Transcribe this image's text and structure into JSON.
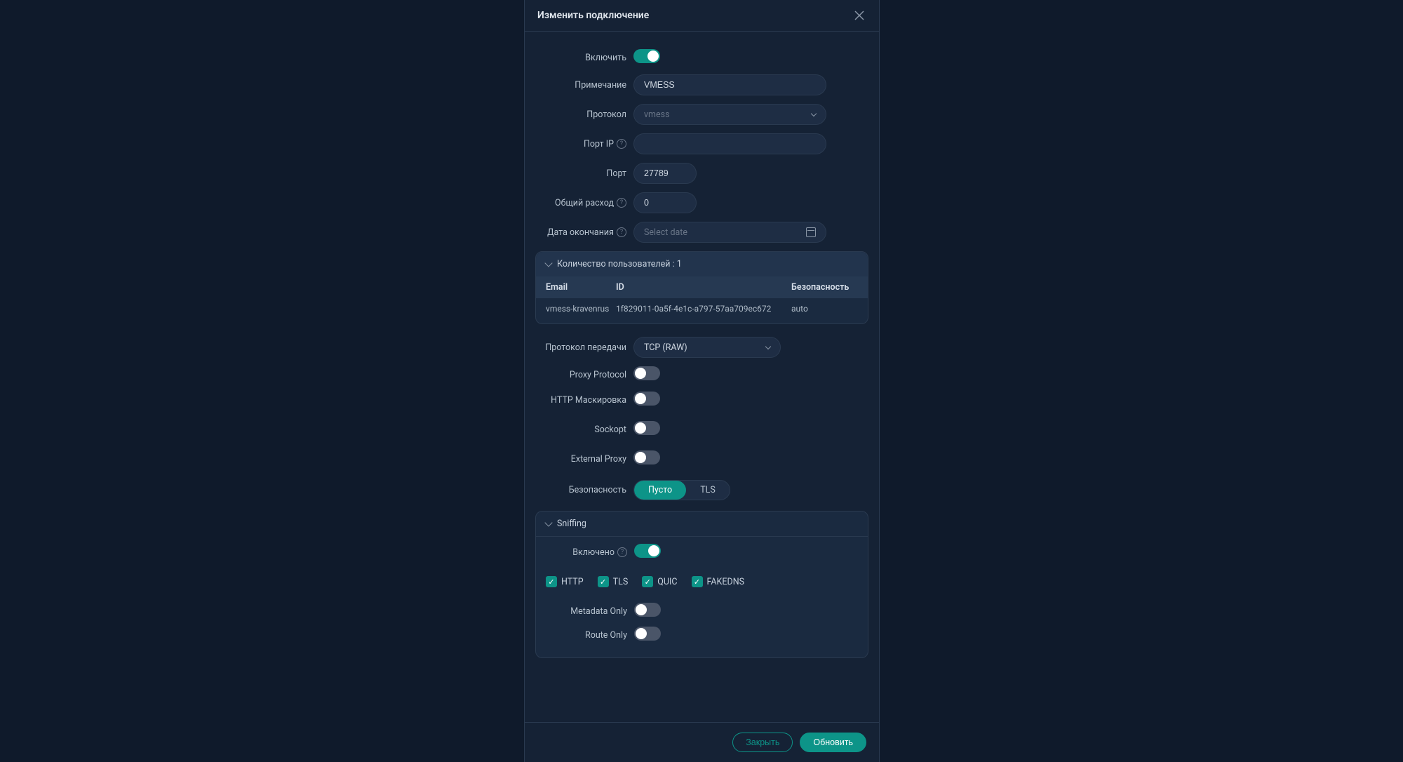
{
  "modal": {
    "title": "Изменить подключение",
    "labels": {
      "enable": "Включить",
      "note": "Примечание",
      "protocol": "Протокол",
      "ip_port": "Порт IP",
      "port": "Порт",
      "total": "Общий расход",
      "expiry": "Дата окончания",
      "transport": "Протокол передачи",
      "proxy_protocol": "Proxy Protocol",
      "http_mask": "HTTP Маскировка",
      "sockopt": "Sockopt",
      "external_proxy": "External Proxy",
      "security": "Безопасность",
      "sniff_enabled": "Включено",
      "metadata_only": "Metadata Only",
      "route_only": "Route Only"
    },
    "values": {
      "note": "VMESS",
      "protocol": "vmess",
      "ip_port": "",
      "port": "27789",
      "total": "0",
      "expiry_placeholder": "Select date",
      "transport": "TCP (RAW)"
    },
    "users_panel": {
      "title": "Количество пользователей : 1",
      "headers": {
        "email": "Email",
        "id": "ID",
        "security": "Безопасность"
      },
      "rows": [
        {
          "email": "vmess-kravenrus",
          "id": "1f829011-0a5f-4e1c-a797-57aa709ec672",
          "security": "auto"
        }
      ]
    },
    "security_segment": {
      "empty": "Пусто",
      "tls": "TLS"
    },
    "sniffing": {
      "title": "Sniffing",
      "options": {
        "http": "HTTP",
        "tls": "TLS",
        "quic": "QUIC",
        "fakedns": "FAKEDNS"
      }
    },
    "footer": {
      "close": "Закрыть",
      "update": "Обновить"
    }
  }
}
